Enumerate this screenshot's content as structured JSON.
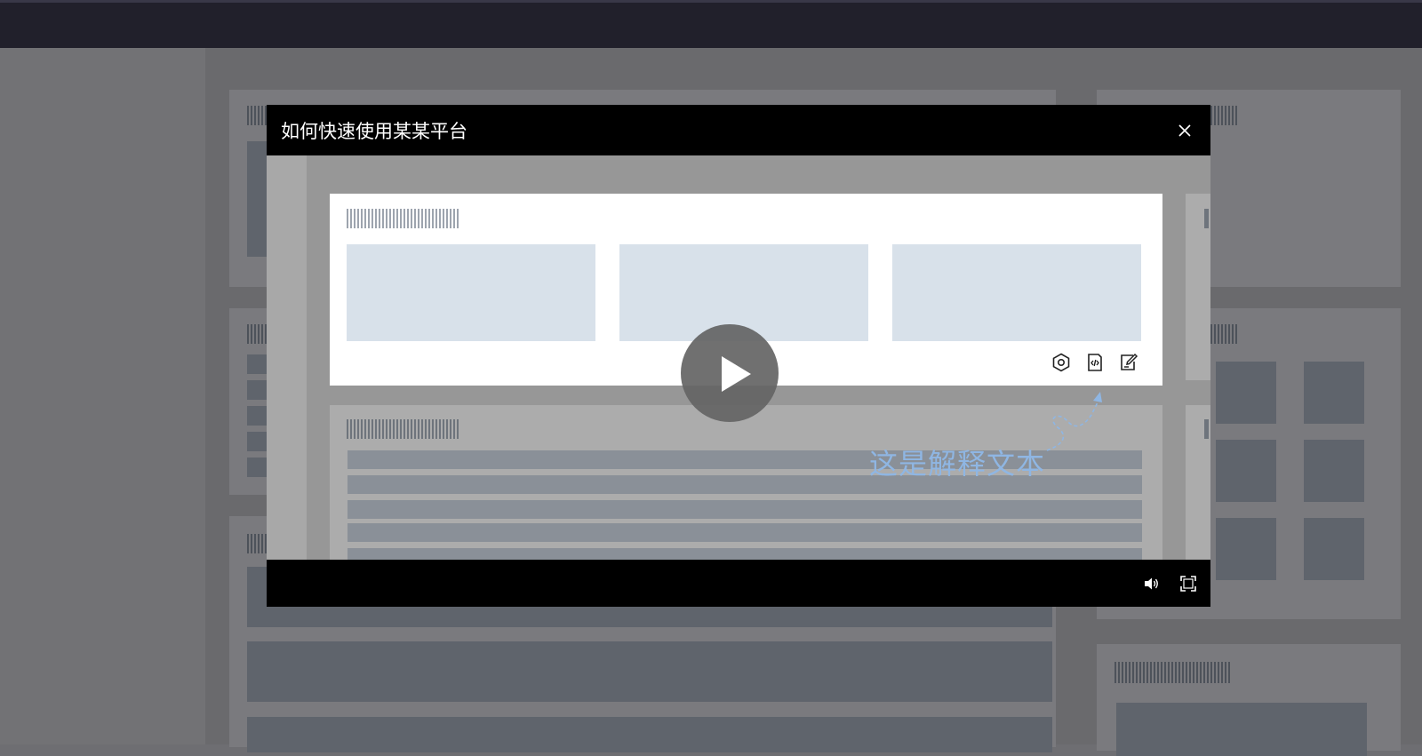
{
  "modal": {
    "title": "如何快速使用某某平台",
    "close_icon": "close-icon"
  },
  "video": {
    "play_icon": "play-icon",
    "annotation_text": "这是解释文本",
    "toolbar_icons": [
      "settings-hexagon-icon",
      "code-file-icon",
      "edit-note-icon"
    ]
  },
  "controls": {
    "volume_icon": "volume-icon",
    "fullscreen_icon": "fullscreen-icon"
  },
  "colors": {
    "annotation": "#8fb6e3",
    "modal_background": "#000000",
    "topbar": "#21202b"
  }
}
